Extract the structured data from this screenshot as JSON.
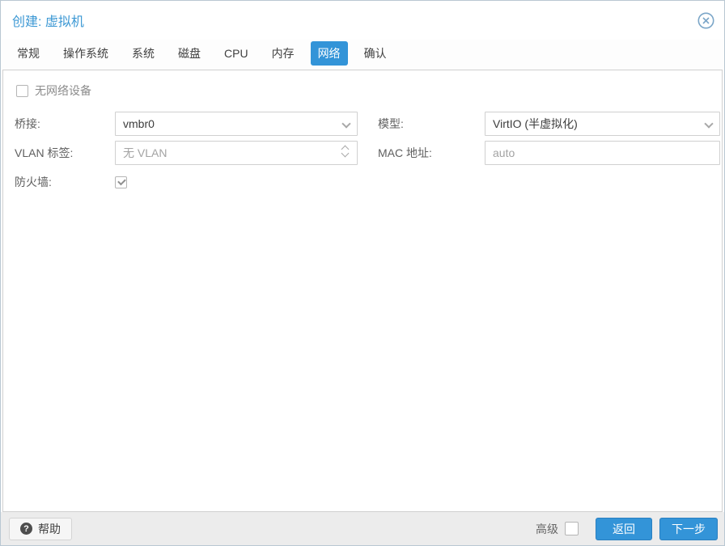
{
  "window": {
    "title": "创建: 虚拟机"
  },
  "tabs": {
    "items": [
      "常规",
      "操作系统",
      "系统",
      "磁盘",
      "CPU",
      "内存",
      "网络",
      "确认"
    ],
    "active": "网络"
  },
  "form": {
    "no_net": {
      "label": "无网络设备",
      "checked": false
    },
    "bridge": {
      "label": "桥接:",
      "value": "vmbr0"
    },
    "vlan": {
      "label": "VLAN 标签:",
      "placeholder": "无 VLAN"
    },
    "firewall": {
      "label": "防火墙:",
      "checked": true
    },
    "model": {
      "label": "模型:",
      "value": "VirtIO (半虚拟化)"
    },
    "mac": {
      "label": "MAC 地址:",
      "placeholder": "auto"
    }
  },
  "footer": {
    "help_label": "帮助",
    "help_icon_glyph": "?",
    "advanced_label": "高级",
    "advanced_checked": false,
    "back_label": "返回",
    "next_label": "下一步"
  },
  "colors": {
    "accent_blue": "#3394d8",
    "title_blue": "#3c98d4",
    "border_grey": "#d0d0d0",
    "footer_grey": "#ececec"
  }
}
